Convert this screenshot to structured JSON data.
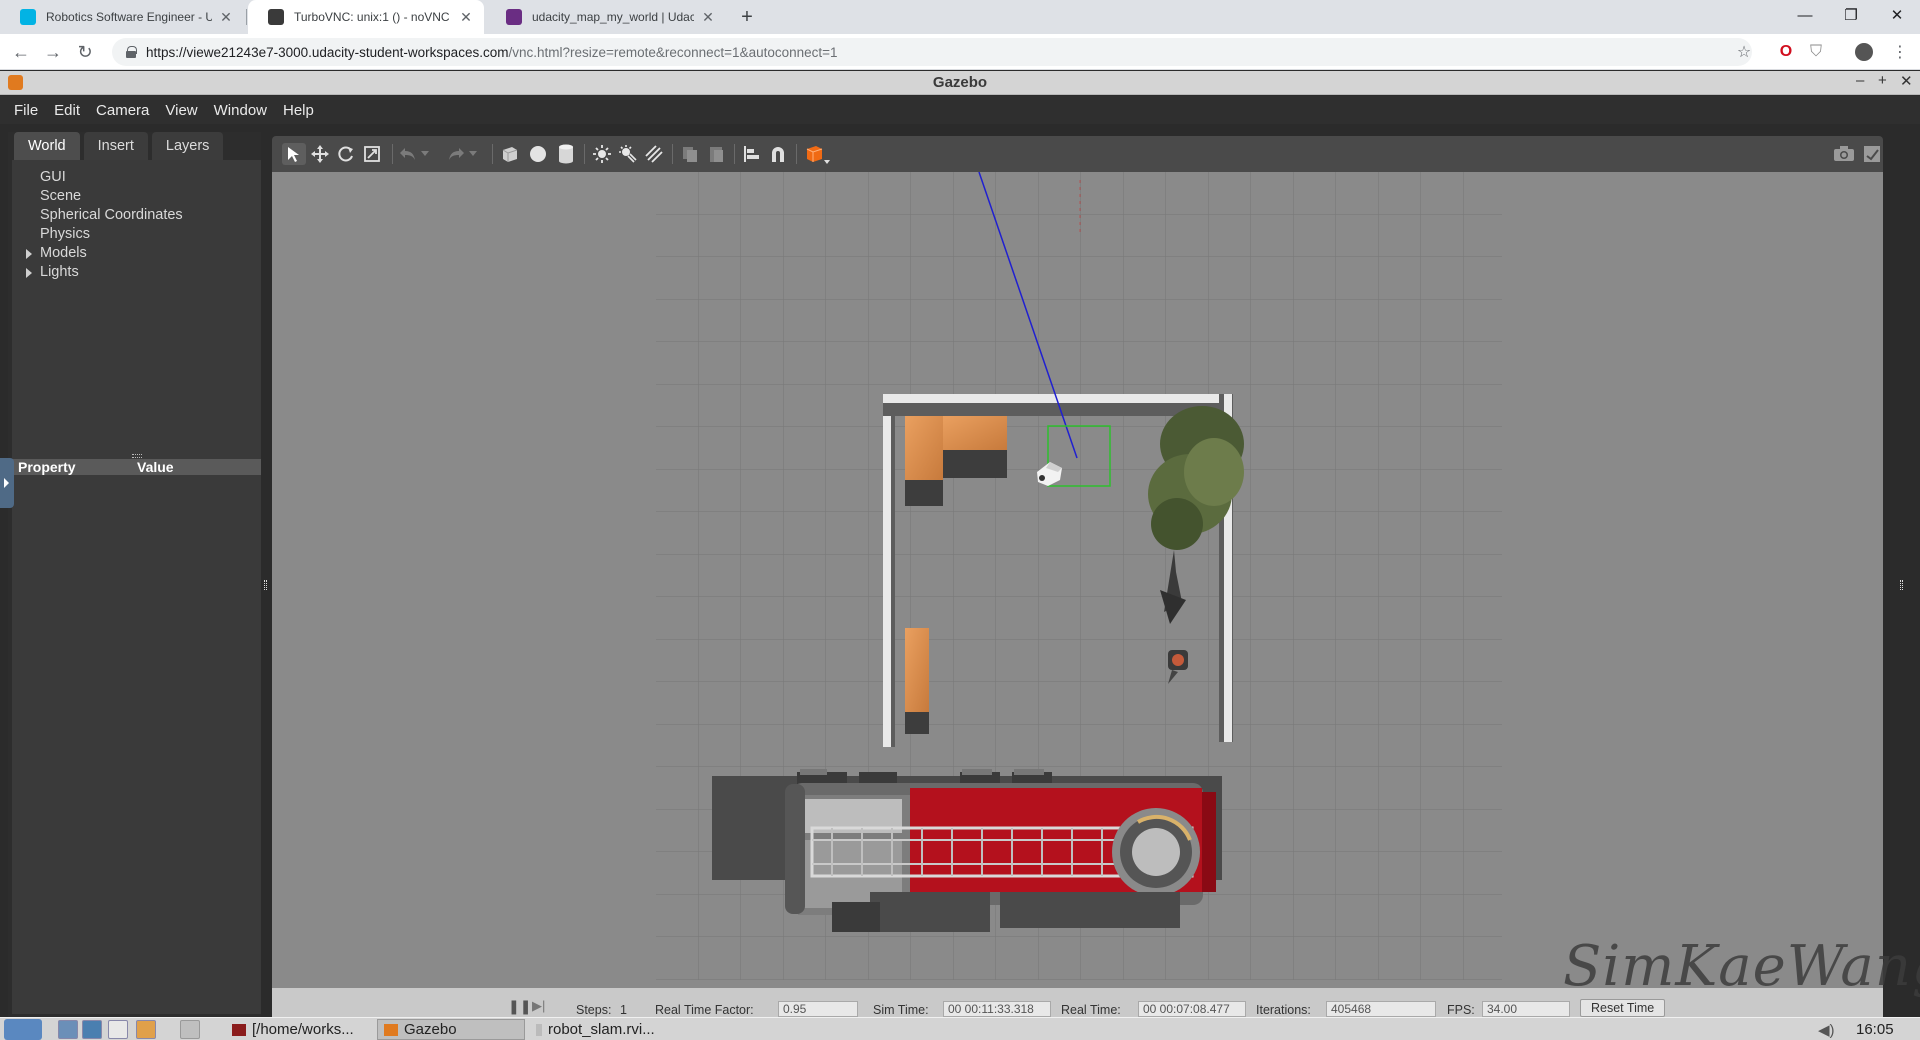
{
  "browser": {
    "tabs": [
      {
        "title": "Robotics Software Engineer - Uda",
        "active": false,
        "favicon_color": "#02b3e4"
      },
      {
        "title": "TurboVNC: unix:1 () - noVNC",
        "active": true,
        "favicon_color": "#3a3a3a"
      },
      {
        "title": "udacity_map_my_world | Udacity",
        "active": false,
        "favicon_color": "#6a2d83"
      }
    ],
    "url_host": "https://viewe21243e7-3000.udacity-student-workspaces.com",
    "url_path": "/vnc.html?resize=remote&reconnect=1&autoconnect=1"
  },
  "gazebo": {
    "window_title": "Gazebo",
    "menu": [
      "File",
      "Edit",
      "Camera",
      "View",
      "Window",
      "Help"
    ],
    "left_tabs": [
      "World",
      "Insert",
      "Layers"
    ],
    "tree": [
      {
        "label": "GUI",
        "expandable": false
      },
      {
        "label": "Scene",
        "expandable": false
      },
      {
        "label": "Spherical Coordinates",
        "expandable": false
      },
      {
        "label": "Physics",
        "expandable": false
      },
      {
        "label": "Models",
        "expandable": true
      },
      {
        "label": "Lights",
        "expandable": true
      }
    ],
    "property_header": "Property",
    "value_header": "Value",
    "status": {
      "steps_label": "Steps:",
      "steps_value": "1",
      "rtf_label": "Real Time Factor:",
      "rtf_value": "0.95",
      "sim_time_label": "Sim Time:",
      "sim_time_value": "00 00:11:33.318",
      "real_time_label": "Real Time:",
      "real_time_value": "00 00:07:08.477",
      "iterations_label": "Iterations:",
      "iterations_value": "405468",
      "fps_label": "FPS:",
      "fps_value": "34.00",
      "reset_label": "Reset Time"
    },
    "colors": {
      "wall": "#555555",
      "wall_top": "#e9e9e9",
      "cabinet": "#d98a4a",
      "truck_red": "#b4111d",
      "laser": "#2020d0",
      "selection": "#2ec02e"
    }
  },
  "taskbar": {
    "tasks": [
      {
        "label": "[/home/works...",
        "active": false
      },
      {
        "label": "Gazebo",
        "active": true
      },
      {
        "label": "robot_slam.rvi...",
        "active": false
      }
    ],
    "clock": "16:05"
  },
  "watermark": "SimKaeWang"
}
